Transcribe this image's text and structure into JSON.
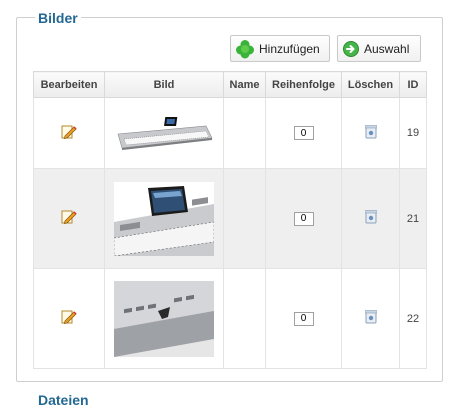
{
  "section": {
    "title": "Bilder",
    "next_title": "Dateien"
  },
  "toolbar": {
    "add_label": "Hinzufügen",
    "select_label": "Auswahl"
  },
  "table": {
    "headers": [
      "Bearbeiten",
      "Bild",
      "Name",
      "Reihenfolge",
      "Löschen",
      "ID"
    ],
    "rows": [
      {
        "name": "",
        "order": "0",
        "id": "19",
        "image": "keyboard-photo-front"
      },
      {
        "name": "",
        "order": "0",
        "id": "21",
        "image": "keyboard-photo-display"
      },
      {
        "name": "",
        "order": "0",
        "id": "22",
        "image": "keyboard-photo-panel-closeup"
      }
    ]
  },
  "icons": {
    "edit": "edit-pencil-icon",
    "delete": "trash-icon",
    "add": "green-plus-icon",
    "select": "green-arrow-circle-icon"
  },
  "colors": {
    "legend": "#236893",
    "add_icon": "#3bb33b"
  }
}
